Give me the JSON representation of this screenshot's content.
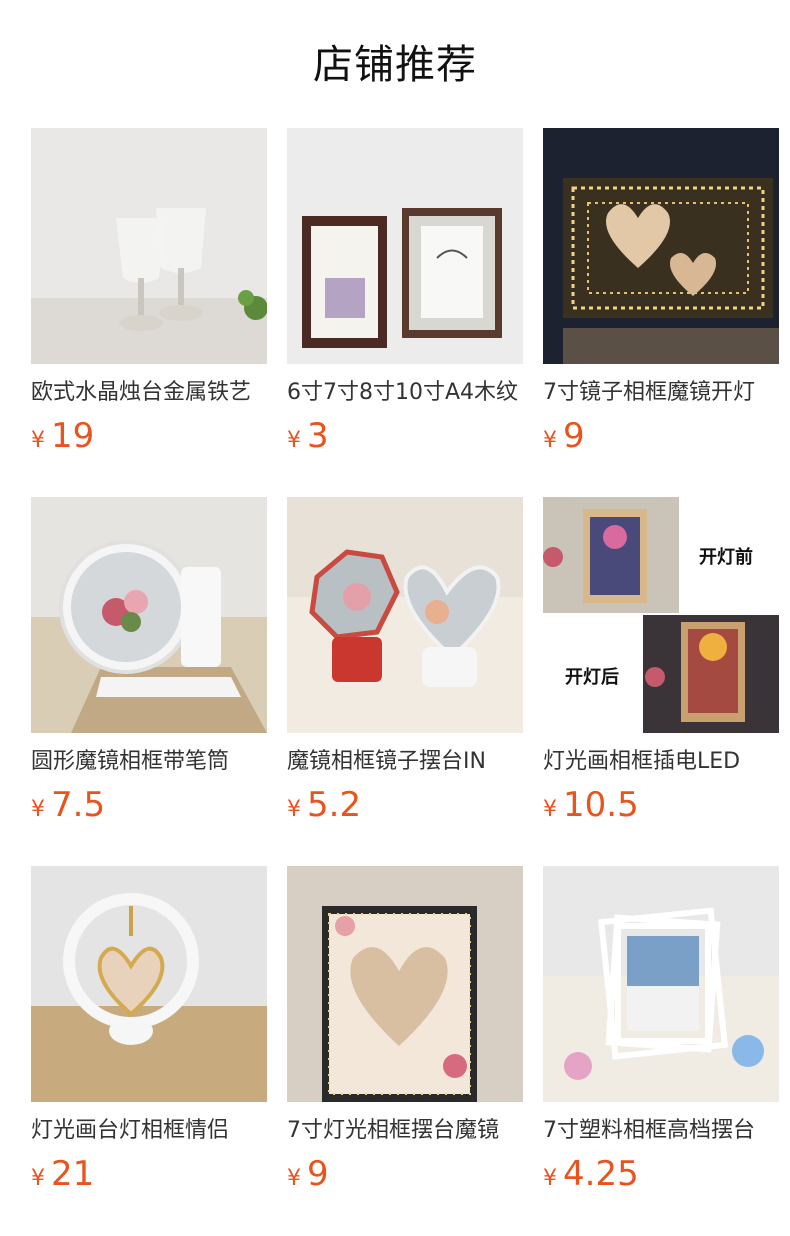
{
  "page_title": "店铺推荐",
  "currency": "¥",
  "colors": {
    "price": "#e8541e"
  },
  "products": [
    {
      "name": "欧式水晶烛台金属铁艺",
      "price": "19",
      "image": "crystal-candle-holders"
    },
    {
      "name": "6寸7寸8寸10寸A4木纹",
      "price": "3",
      "image": "photo-frames-pair"
    },
    {
      "name": "7寸镜子相框魔镜开灯",
      "price": "9",
      "image": "infinity-mirror-heart-frame"
    },
    {
      "name": "圆形魔镜相框带笔筒",
      "price": "7.5",
      "image": "round-mirror-pen-holder"
    },
    {
      "name": "魔镜相框镜子摆台IN",
      "price": "5.2",
      "image": "hexagon-heart-mirrors"
    },
    {
      "name": "灯光画相框插电LED",
      "price": "10.5",
      "image": "led-light-painting",
      "overlay": {
        "before": "开灯前",
        "after": "开灯后"
      }
    },
    {
      "name": "灯光画台灯相框情侣",
      "price": "21",
      "image": "ring-lamp-heart-frame"
    },
    {
      "name": "7寸灯光相框摆台魔镜",
      "price": "9",
      "image": "heart-light-frame"
    },
    {
      "name": "7寸塑料相框高档摆台",
      "price": "4.25",
      "image": "stacked-white-frames"
    }
  ]
}
